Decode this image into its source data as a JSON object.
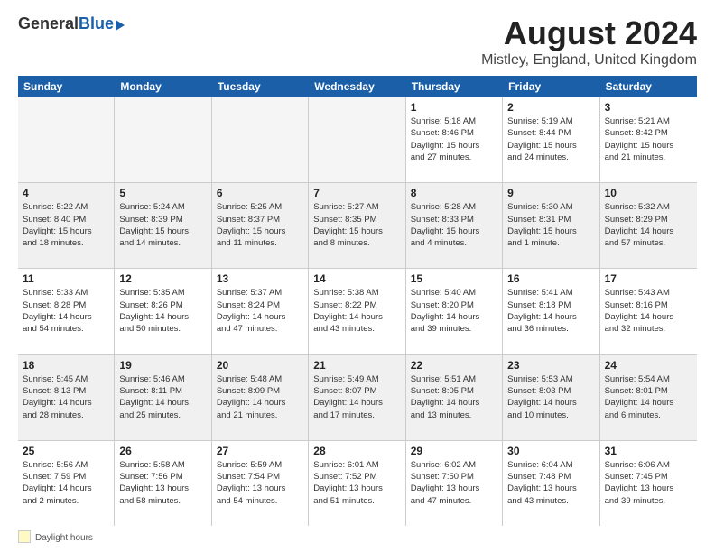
{
  "logo": {
    "general": "General",
    "blue": "Blue"
  },
  "title": "August 2024",
  "subtitle": "Mistley, England, United Kingdom",
  "days": [
    "Sunday",
    "Monday",
    "Tuesday",
    "Wednesday",
    "Thursday",
    "Friday",
    "Saturday"
  ],
  "footer": {
    "legend_label": "Daylight hours"
  },
  "weeks": [
    [
      {
        "day": "",
        "content": ""
      },
      {
        "day": "",
        "content": ""
      },
      {
        "day": "",
        "content": ""
      },
      {
        "day": "",
        "content": ""
      },
      {
        "day": "1",
        "content": "Sunrise: 5:18 AM\nSunset: 8:46 PM\nDaylight: 15 hours\nand 27 minutes."
      },
      {
        "day": "2",
        "content": "Sunrise: 5:19 AM\nSunset: 8:44 PM\nDaylight: 15 hours\nand 24 minutes."
      },
      {
        "day": "3",
        "content": "Sunrise: 5:21 AM\nSunset: 8:42 PM\nDaylight: 15 hours\nand 21 minutes."
      }
    ],
    [
      {
        "day": "4",
        "content": "Sunrise: 5:22 AM\nSunset: 8:40 PM\nDaylight: 15 hours\nand 18 minutes."
      },
      {
        "day": "5",
        "content": "Sunrise: 5:24 AM\nSunset: 8:39 PM\nDaylight: 15 hours\nand 14 minutes."
      },
      {
        "day": "6",
        "content": "Sunrise: 5:25 AM\nSunset: 8:37 PM\nDaylight: 15 hours\nand 11 minutes."
      },
      {
        "day": "7",
        "content": "Sunrise: 5:27 AM\nSunset: 8:35 PM\nDaylight: 15 hours\nand 8 minutes."
      },
      {
        "day": "8",
        "content": "Sunrise: 5:28 AM\nSunset: 8:33 PM\nDaylight: 15 hours\nand 4 minutes."
      },
      {
        "day": "9",
        "content": "Sunrise: 5:30 AM\nSunset: 8:31 PM\nDaylight: 15 hours\nand 1 minute."
      },
      {
        "day": "10",
        "content": "Sunrise: 5:32 AM\nSunset: 8:29 PM\nDaylight: 14 hours\nand 57 minutes."
      }
    ],
    [
      {
        "day": "11",
        "content": "Sunrise: 5:33 AM\nSunset: 8:28 PM\nDaylight: 14 hours\nand 54 minutes."
      },
      {
        "day": "12",
        "content": "Sunrise: 5:35 AM\nSunset: 8:26 PM\nDaylight: 14 hours\nand 50 minutes."
      },
      {
        "day": "13",
        "content": "Sunrise: 5:37 AM\nSunset: 8:24 PM\nDaylight: 14 hours\nand 47 minutes."
      },
      {
        "day": "14",
        "content": "Sunrise: 5:38 AM\nSunset: 8:22 PM\nDaylight: 14 hours\nand 43 minutes."
      },
      {
        "day": "15",
        "content": "Sunrise: 5:40 AM\nSunset: 8:20 PM\nDaylight: 14 hours\nand 39 minutes."
      },
      {
        "day": "16",
        "content": "Sunrise: 5:41 AM\nSunset: 8:18 PM\nDaylight: 14 hours\nand 36 minutes."
      },
      {
        "day": "17",
        "content": "Sunrise: 5:43 AM\nSunset: 8:16 PM\nDaylight: 14 hours\nand 32 minutes."
      }
    ],
    [
      {
        "day": "18",
        "content": "Sunrise: 5:45 AM\nSunset: 8:13 PM\nDaylight: 14 hours\nand 28 minutes."
      },
      {
        "day": "19",
        "content": "Sunrise: 5:46 AM\nSunset: 8:11 PM\nDaylight: 14 hours\nand 25 minutes."
      },
      {
        "day": "20",
        "content": "Sunrise: 5:48 AM\nSunset: 8:09 PM\nDaylight: 14 hours\nand 21 minutes."
      },
      {
        "day": "21",
        "content": "Sunrise: 5:49 AM\nSunset: 8:07 PM\nDaylight: 14 hours\nand 17 minutes."
      },
      {
        "day": "22",
        "content": "Sunrise: 5:51 AM\nSunset: 8:05 PM\nDaylight: 14 hours\nand 13 minutes."
      },
      {
        "day": "23",
        "content": "Sunrise: 5:53 AM\nSunset: 8:03 PM\nDaylight: 14 hours\nand 10 minutes."
      },
      {
        "day": "24",
        "content": "Sunrise: 5:54 AM\nSunset: 8:01 PM\nDaylight: 14 hours\nand 6 minutes."
      }
    ],
    [
      {
        "day": "25",
        "content": "Sunrise: 5:56 AM\nSunset: 7:59 PM\nDaylight: 14 hours\nand 2 minutes."
      },
      {
        "day": "26",
        "content": "Sunrise: 5:58 AM\nSunset: 7:56 PM\nDaylight: 13 hours\nand 58 minutes."
      },
      {
        "day": "27",
        "content": "Sunrise: 5:59 AM\nSunset: 7:54 PM\nDaylight: 13 hours\nand 54 minutes."
      },
      {
        "day": "28",
        "content": "Sunrise: 6:01 AM\nSunset: 7:52 PM\nDaylight: 13 hours\nand 51 minutes."
      },
      {
        "day": "29",
        "content": "Sunrise: 6:02 AM\nSunset: 7:50 PM\nDaylight: 13 hours\nand 47 minutes."
      },
      {
        "day": "30",
        "content": "Sunrise: 6:04 AM\nSunset: 7:48 PM\nDaylight: 13 hours\nand 43 minutes."
      },
      {
        "day": "31",
        "content": "Sunrise: 6:06 AM\nSunset: 7:45 PM\nDaylight: 13 hours\nand 39 minutes."
      }
    ]
  ]
}
